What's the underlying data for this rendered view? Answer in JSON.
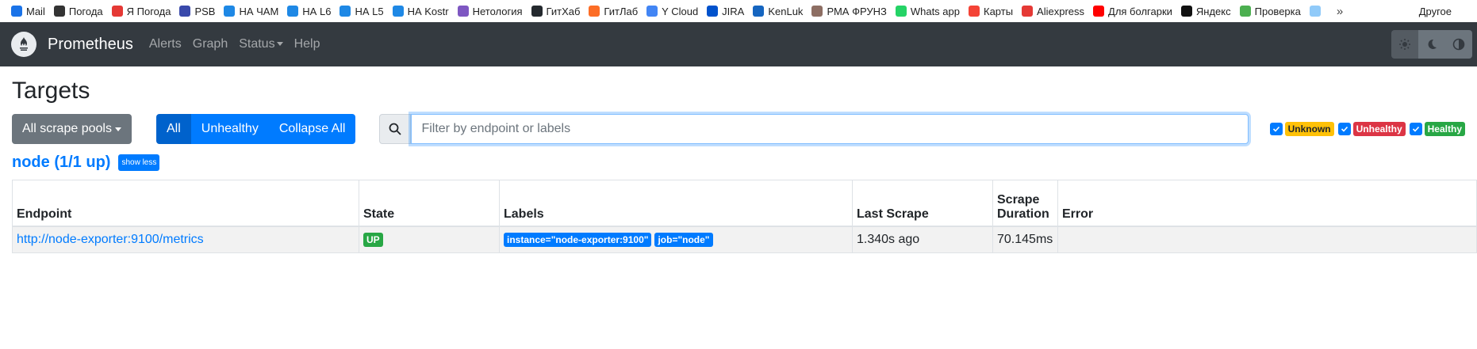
{
  "bookmarks": {
    "items": [
      {
        "label": "Mail",
        "color": "#1a73e8"
      },
      {
        "label": "Погода",
        "color": "#333333"
      },
      {
        "label": "Я Погода",
        "color": "#e53935"
      },
      {
        "label": "PSB",
        "color": "#3949ab"
      },
      {
        "label": "НА ЧАМ",
        "color": "#1e88e5"
      },
      {
        "label": "НА L6",
        "color": "#1e88e5"
      },
      {
        "label": "НА L5",
        "color": "#1e88e5"
      },
      {
        "label": "НА Kostr",
        "color": "#1e88e5"
      },
      {
        "label": "Нетология",
        "color": "#7e57c2"
      },
      {
        "label": "ГитХаб",
        "color": "#24292e"
      },
      {
        "label": "ГитЛаб",
        "color": "#fc6d26"
      },
      {
        "label": "Y Cloud",
        "color": "#4285f4"
      },
      {
        "label": "JIRA",
        "color": "#0052cc"
      },
      {
        "label": "KenLuk",
        "color": "#1565c0"
      },
      {
        "label": "РМА ФРУНЗ",
        "color": "#8d6e63"
      },
      {
        "label": "Whats app",
        "color": "#25d366"
      },
      {
        "label": "Карты",
        "color": "#f44336"
      },
      {
        "label": "Aliexpress",
        "color": "#e53935"
      },
      {
        "label": "Для болгарки",
        "color": "#ff0000"
      },
      {
        "label": "Яндекс",
        "color": "#111111"
      },
      {
        "label": "Проверка",
        "color": "#4caf50"
      },
      {
        "label": "",
        "color": "#90caf9"
      }
    ],
    "more": "»",
    "other": "Другое"
  },
  "navbar": {
    "brand": "Prometheus",
    "links": [
      "Alerts",
      "Graph",
      "Status",
      "Help"
    ]
  },
  "page": {
    "title": "Targets",
    "scrape_pools_btn": "All scrape pools",
    "filter_buttons": [
      "All",
      "Unhealthy",
      "Collapse All"
    ],
    "search_placeholder": "Filter by endpoint or labels",
    "badges": {
      "unknown": "Unknown",
      "unhealthy": "Unhealthy",
      "healthy": "Healthy"
    }
  },
  "pool": {
    "title": "node (1/1 up)",
    "toggle": "show less",
    "columns": [
      "Endpoint",
      "State",
      "Labels",
      "Last Scrape",
      "Scrape Duration",
      "Error"
    ],
    "rows": [
      {
        "endpoint": "http://node-exporter:9100/metrics",
        "state": "UP",
        "labels": [
          "instance=\"node-exporter:9100\"",
          "job=\"node\""
        ],
        "last_scrape": "1.340s ago",
        "duration": "70.145ms",
        "error": ""
      }
    ]
  }
}
